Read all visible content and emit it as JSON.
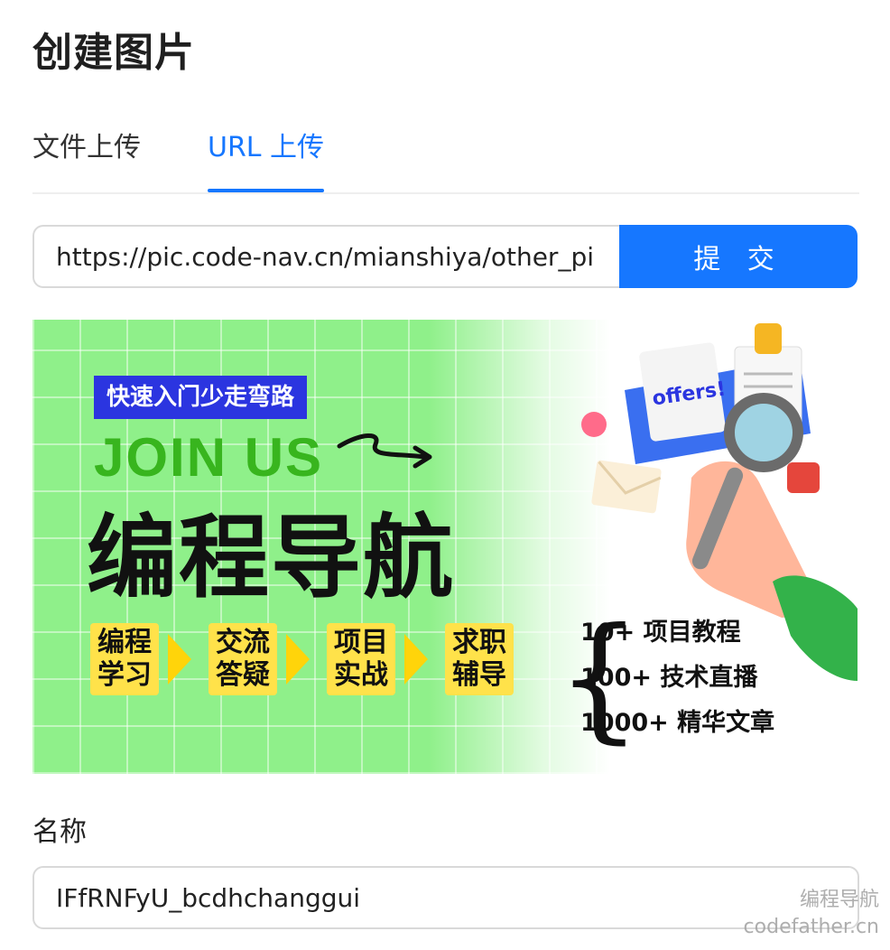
{
  "page": {
    "title": "创建图片"
  },
  "tabs": [
    {
      "label": "文件上传",
      "active": false
    },
    {
      "label": "URL 上传",
      "active": true
    }
  ],
  "url_form": {
    "value": "https://pic.code-nav.cn/mianshiya/other_pi",
    "submit_label": "提 交"
  },
  "preview": {
    "tagline": "快速入门少走弯路",
    "join": "JOIN US",
    "title": "编程导航",
    "steps": [
      {
        "line1": "编程",
        "line2": "学习"
      },
      {
        "line1": "交流",
        "line2": "答疑"
      },
      {
        "line1": "项目",
        "line2": "实战"
      },
      {
        "line1": "求职",
        "line2": "辅导"
      }
    ],
    "features": [
      "10+ 项目教程",
      "100+ 技术直播",
      "1000+ 精华文章"
    ],
    "offer_text": "offers!"
  },
  "name_field": {
    "label": "名称",
    "value": "IFfRNFyU_bcdhchanggui"
  },
  "watermark": {
    "line1": "编程导航",
    "line2": "codefather.cn"
  },
  "colors": {
    "accent": "#1677ff",
    "banner_green": "#8ff08a",
    "tagline_blue": "#2b35e0",
    "join_green": "#38b51e",
    "step_yellow": "#ffe24a"
  }
}
